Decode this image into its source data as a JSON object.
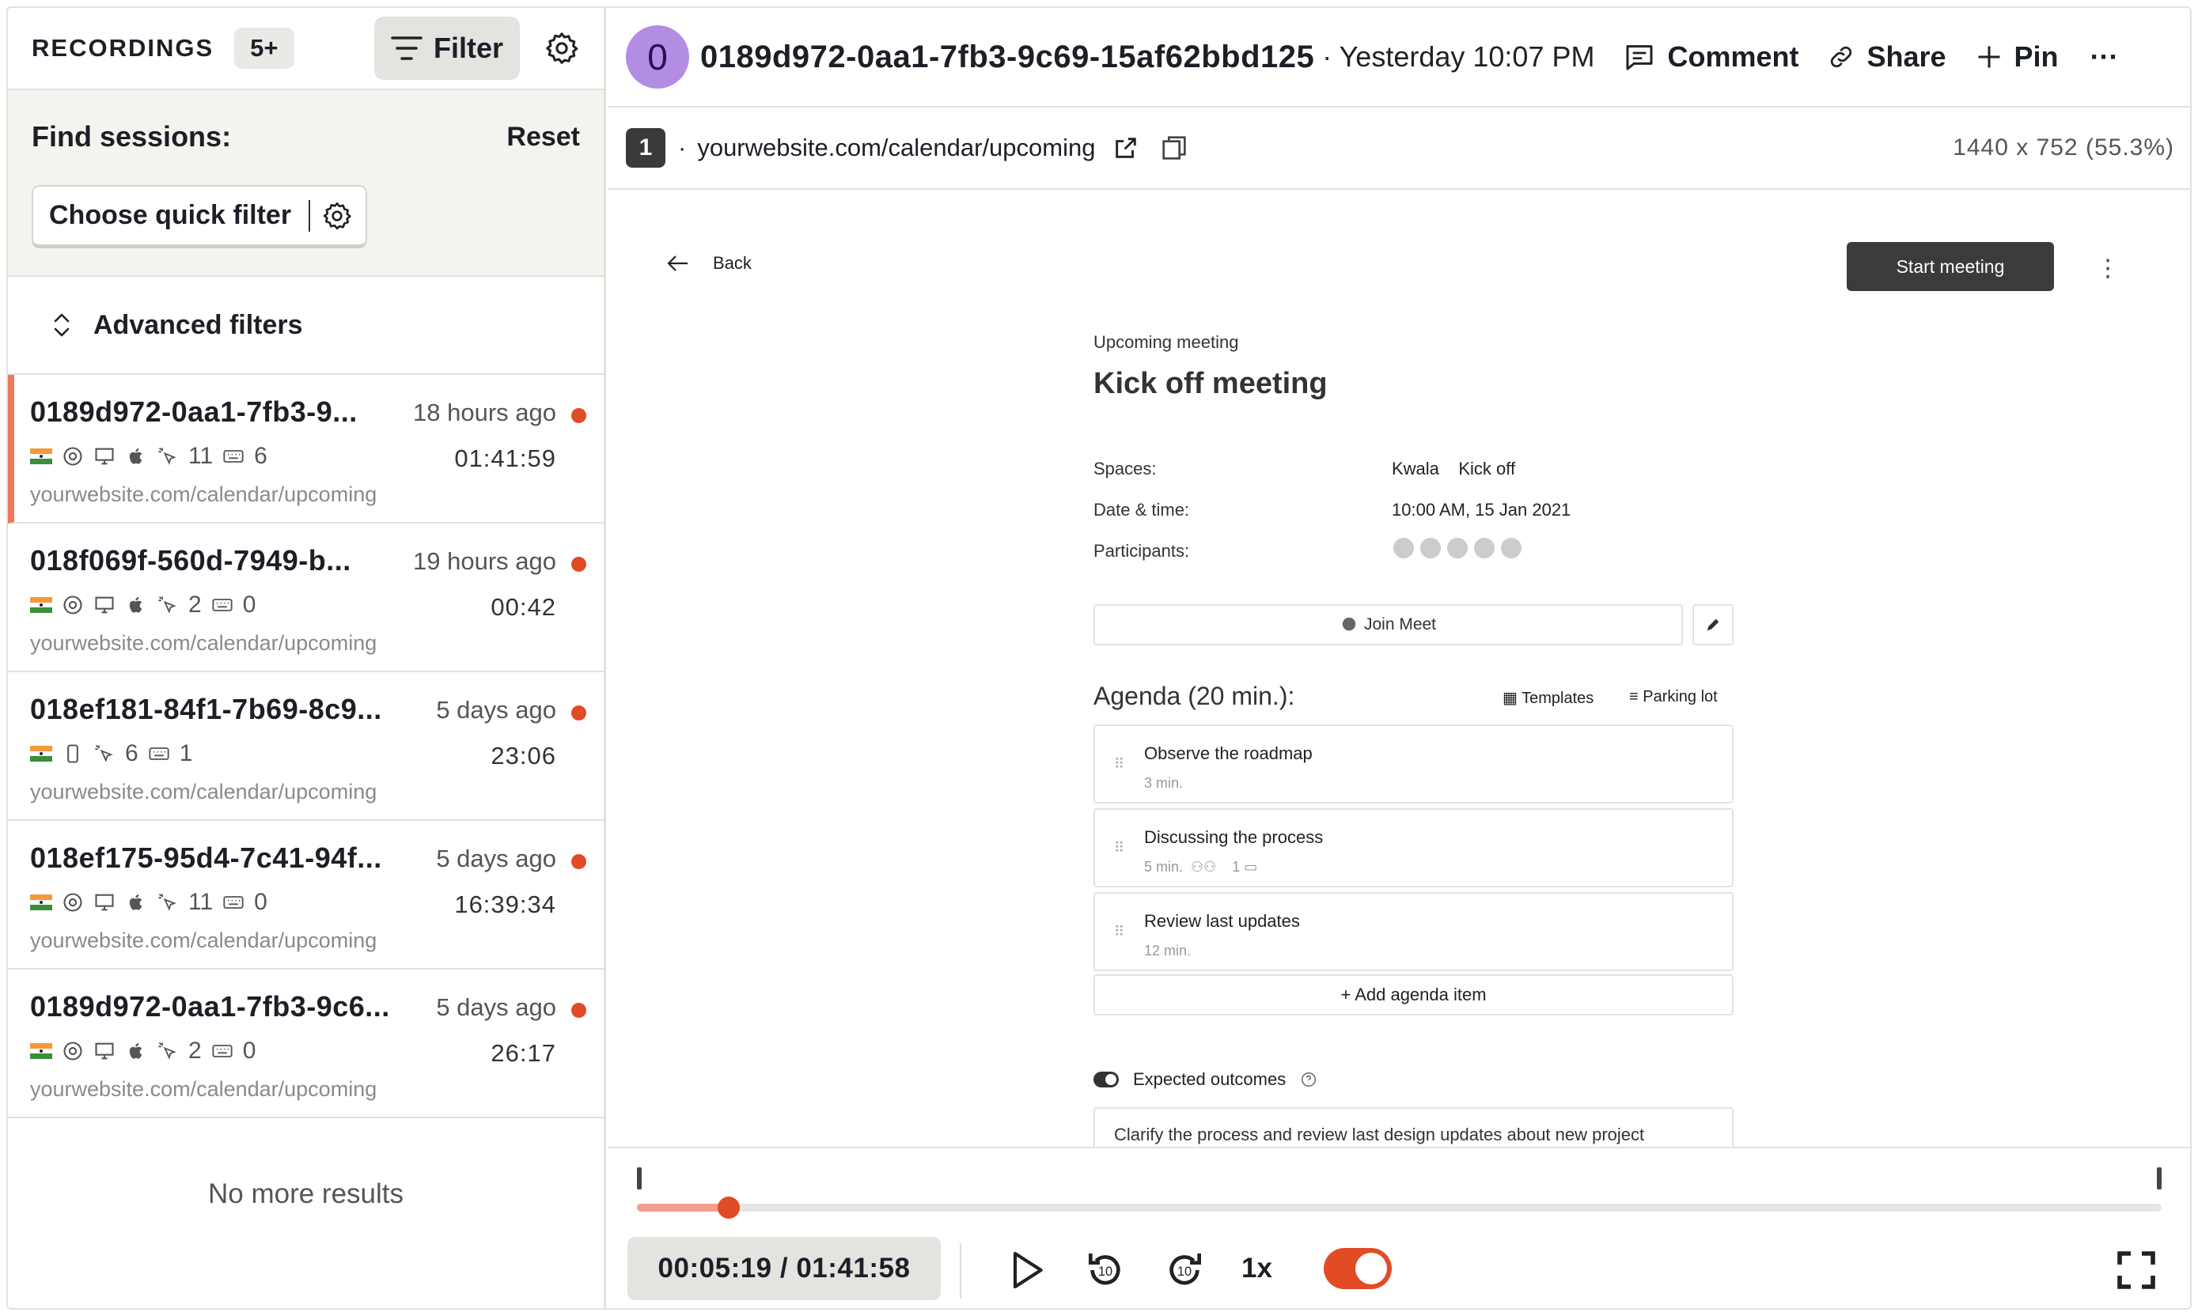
{
  "sidebar": {
    "title": "RECORDINGS",
    "count": "5+",
    "filter_label": "Filter",
    "find_title": "Find sessions:",
    "reset_label": "Reset",
    "quick_filter_label": "Choose quick filter",
    "advanced_label": "Advanced filters",
    "recordings": [
      {
        "id": "0189d972-0aa1-7fb3-9...",
        "ago": "18 hours ago",
        "clicks": "11",
        "keys": "6",
        "duration": "01:41:59",
        "url": "yourwebsite.com/calendar/upcoming"
      },
      {
        "id": "018f069f-560d-7949-b...",
        "ago": "19 hours ago",
        "clicks": "2",
        "keys": "0",
        "duration": "00:42",
        "url": "yourwebsite.com/calendar/upcoming"
      },
      {
        "id": "018ef181-84f1-7b69-8c9...",
        "ago": "5 days ago",
        "clicks": "6",
        "keys": "1",
        "duration": "23:06",
        "url": "yourwebsite.com/calendar/upcoming"
      },
      {
        "id": "018ef175-95d4-7c41-94f...",
        "ago": "5 days ago",
        "clicks": "11",
        "keys": "0",
        "duration": "16:39:34",
        "url": "yourwebsite.com/calendar/upcoming"
      },
      {
        "id": "0189d972-0aa1-7fb3-9c6...",
        "ago": "5 days ago",
        "clicks": "2",
        "keys": "0",
        "duration": "26:17",
        "url": "yourwebsite.com/calendar/upcoming"
      }
    ],
    "no_more": "No more results"
  },
  "header": {
    "avatar_letter": "0",
    "session_id": "0189d972-0aa1-7fb3-9c69-15af62bbd125",
    "when": "· Yesterday 10:07 PM",
    "comment_label": "Comment",
    "share_label": "Share",
    "pin_label": "Pin",
    "more_label": "···"
  },
  "urlbar": {
    "tab_number": "1",
    "bullet": "·",
    "url": "yourwebsite.com/calendar/upcoming",
    "dims": "1440 x 752 (55.3%)"
  },
  "page": {
    "back_label": "Back",
    "start_label": "Start meeting",
    "kebab": "⋮",
    "upcoming": "Upcoming meeting",
    "title": "Kick off meeting",
    "spaces_label": "Spaces:",
    "spaces_value": "Kwala    Kick off",
    "date_label": "Date & time:",
    "date_value": "10:00 AM, 15 Jan 2021",
    "participants_label": "Participants:",
    "join_label": "Join Meet",
    "agenda_title": "Agenda (20 min.):",
    "templates_label": "Templates",
    "parking_label": "Parking lot",
    "agenda": [
      {
        "title": "Observe the roadmap",
        "sub": "3 min."
      },
      {
        "title": "Discussing the process",
        "sub": "5 min.  ⚇⚇    1 ▭"
      },
      {
        "title": "Review last updates",
        "sub": "12 min."
      }
    ],
    "add_label": "+ Add agenda item",
    "expected_label": "Expected outcomes",
    "outcome_text": "Clarify the process and review last design updates about new project"
  },
  "player": {
    "time": "00:05:19 / 01:41:58",
    "speed": "1x",
    "progress": 0.06,
    "accent": "#e14b25"
  }
}
